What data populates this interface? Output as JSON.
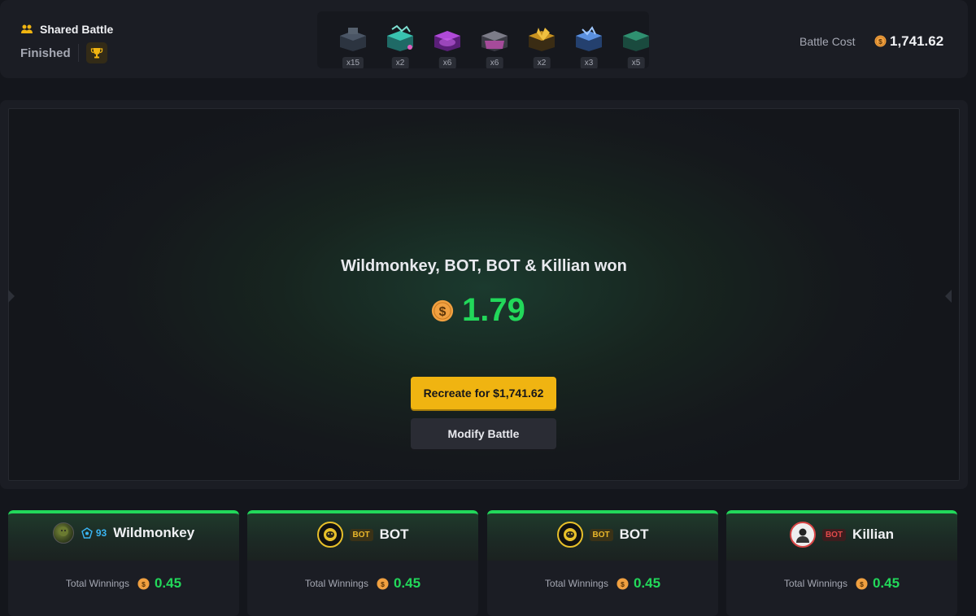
{
  "header": {
    "battle_type": "Shared Battle",
    "status": "Finished",
    "battle_cost_label": "Battle Cost",
    "battle_cost_value": "1,741.62",
    "cases": [
      {
        "name": "dark-case-icon",
        "count": "x15",
        "color": "#3a4250"
      },
      {
        "name": "teal-case-icon",
        "count": "x2",
        "color": "#2fb8a8"
      },
      {
        "name": "purple-case-icon",
        "count": "x6",
        "color": "#a040c8"
      },
      {
        "name": "pink-case-icon",
        "count": "x6",
        "color": "#c050b0"
      },
      {
        "name": "gold-case-icon",
        "count": "x2",
        "color": "#d4a020"
      },
      {
        "name": "blue-case-icon",
        "count": "x3",
        "color": "#4a80d8"
      },
      {
        "name": "green-case-icon",
        "count": "x5",
        "color": "#2f9070"
      }
    ]
  },
  "main": {
    "winner_text": "Wildmonkey, BOT, BOT & Killian won",
    "prize": "1.79",
    "recreate_label": "Recreate for $1,741.62",
    "modify_label": "Modify Battle"
  },
  "players": [
    {
      "name": "Wildmonkey",
      "level": "93",
      "tag": "",
      "winnings_label": "Total Winnings",
      "winnings": "0.45"
    },
    {
      "name": "BOT",
      "level": "",
      "tag": "BOT",
      "winnings_label": "Total Winnings",
      "winnings": "0.45"
    },
    {
      "name": "BOT",
      "level": "",
      "tag": "BOT",
      "winnings_label": "Total Winnings",
      "winnings": "0.45"
    },
    {
      "name": "Killian",
      "level": "",
      "tag": "BOT",
      "winnings_label": "Total Winnings",
      "winnings": "0.45"
    }
  ],
  "colors": {
    "accent_green": "#22d85a",
    "button_yellow": "#f0b411",
    "coin_orange": "#f0a040"
  }
}
